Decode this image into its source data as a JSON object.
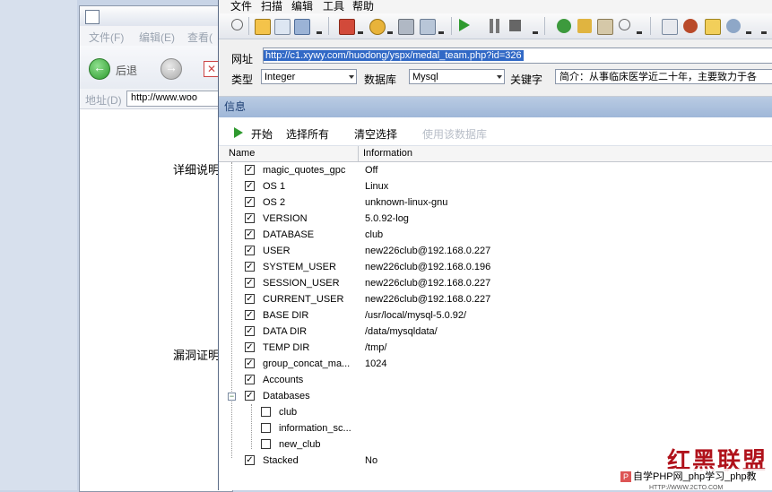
{
  "bg_window": {
    "menu": [
      "文件(F)",
      "编辑(E)",
      "查看("
    ],
    "back_label": "后退",
    "address_label": "地址(D)",
    "address_value": "http://www.woo",
    "side_texts": [
      "详细说明",
      "漏洞证明"
    ]
  },
  "app": {
    "menu": [
      "文件",
      "扫描",
      "编辑",
      "工具",
      "帮助"
    ],
    "url_label": "网址",
    "url_value": "http://c1.xywy.com/huodong/yspx/medal_team.php?id=326",
    "type_label": "类型",
    "type_value": "Integer",
    "db_label": "数据库",
    "db_value": "Mysql",
    "keyword_label": "关键字",
    "keyword_value": "简介：从事临床医学近二十年，主要致力于各",
    "info_header": "信息",
    "actions": {
      "start": "开始",
      "select_all": "选择所有",
      "clear_selection": "清空选择",
      "use_db": "使用该数据库"
    },
    "columns": {
      "name": "Name",
      "information": "Information"
    },
    "rows": [
      {
        "name": "magic_quotes_gpc",
        "value": "Off"
      },
      {
        "name": "OS 1",
        "value": "Linux"
      },
      {
        "name": "OS 2",
        "value": "unknown-linux-gnu"
      },
      {
        "name": "VERSION",
        "value": "5.0.92-log"
      },
      {
        "name": "DATABASE",
        "value": "club"
      },
      {
        "name": "USER",
        "value": "new226club@192.168.0.227"
      },
      {
        "name": "SYSTEM_USER",
        "value": "new226club@192.168.0.196"
      },
      {
        "name": "SESSION_USER",
        "value": "new226club@192.168.0.227"
      },
      {
        "name": "CURRENT_USER",
        "value": "new226club@192.168.0.227"
      },
      {
        "name": "BASE DIR",
        "value": "/usr/local/mysql-5.0.92/"
      },
      {
        "name": "DATA DIR",
        "value": "/data/mysqldata/"
      },
      {
        "name": "TEMP DIR",
        "value": "/tmp/"
      },
      {
        "name": "group_concat_ma...",
        "value": "1024"
      },
      {
        "name": "Accounts",
        "value": ""
      }
    ],
    "databases_label": "Databases",
    "databases": [
      "club",
      "information_sc...",
      "new_club"
    ],
    "stacked": {
      "name": "Stacked",
      "value": "No"
    }
  },
  "watermark": {
    "logo_text": "红黑联盟",
    "site_text": "自学PHP网_php学习_php教",
    "url_text": "HTTP://WWW.2CTO.COM"
  }
}
